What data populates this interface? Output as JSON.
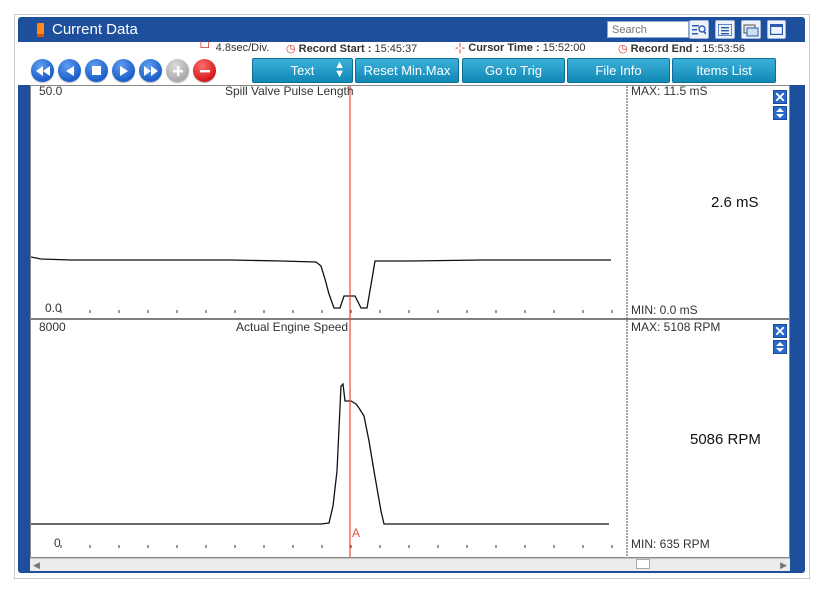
{
  "window": {
    "title": "Current Data",
    "search_placeholder": "Search"
  },
  "toolbar_icons": [
    "search-list-icon",
    "list-icon",
    "retry-icon",
    "window-icon"
  ],
  "info_bar": {
    "time_per_div": "4.8sec/Div.",
    "record_start_label": "Record Start :",
    "record_start_time": "15:45:37",
    "cursor_time_label": "Cursor Time :",
    "cursor_time": "15:52:00",
    "record_end_label": "Record End :",
    "record_end_time": "15:53:56"
  },
  "nav_buttons": [
    "rewind-icon",
    "prev-icon",
    "stop-icon",
    "play-icon",
    "fast-forward-icon",
    "plus-icon",
    "minus-icon"
  ],
  "buttons": {
    "text": "Text",
    "reset": "Reset Min.Max",
    "go_to_trig": "Go to Trig",
    "file_info": "File Info",
    "items_list": "Items List"
  },
  "graphs": [
    {
      "title": "Spill Valve Pulse Length",
      "ymax_label": "50.0",
      "ymin_label": "0.0",
      "max_text": "MAX:  11.5 mS",
      "min_text": "MIN:   0.0 mS",
      "current_value": "2.6 mS"
    },
    {
      "title": "Actual Engine Speed",
      "ymax_label": "8000",
      "ymin_label": "0",
      "max_text": "MAX:  5108 RPM",
      "min_text": "MIN:   635 RPM",
      "current_value": "5086 RPM"
    }
  ],
  "cursor_marker": "A",
  "colors": {
    "window": "#1e4f9c",
    "button": "#1a9ac6",
    "cursor": "#e8493a"
  }
}
